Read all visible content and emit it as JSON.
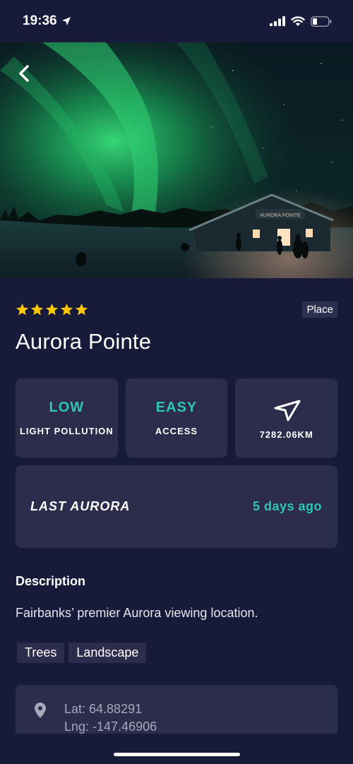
{
  "status_bar": {
    "time": "19:36",
    "icons": [
      "location-arrow-icon",
      "signal-icon",
      "wifi-icon",
      "battery-icon"
    ]
  },
  "hero": {
    "image": "aurora-over-cabin-photo",
    "back_icon": "chevron-left-icon",
    "sign_text": "AURORA POINTE"
  },
  "place": {
    "rating": 5,
    "badge": "Place",
    "title": "Aurora Pointe"
  },
  "stats": {
    "light_pollution": {
      "value": "LOW",
      "label": "LIGHT POLLUTION"
    },
    "access": {
      "value": "EASY",
      "label": "ACCESS"
    },
    "distance": {
      "icon": "navigation-arrow-icon",
      "label": "7282.06KM"
    }
  },
  "last_aurora": {
    "label": "LAST AURORA",
    "value": "5 days ago"
  },
  "description": {
    "heading": "Description",
    "text": "Fairbanks’ premier Aurora viewing location."
  },
  "tags": [
    "Trees",
    "Landscape"
  ],
  "location": {
    "icon": "map-pin-icon",
    "lat": "Lat: 64.88291",
    "lng": "Lng: -147.46906"
  },
  "colors": {
    "background": "#181A3A",
    "card": "#2C2D4C",
    "accent": "#2EC4B6",
    "star": "#FFC800"
  }
}
